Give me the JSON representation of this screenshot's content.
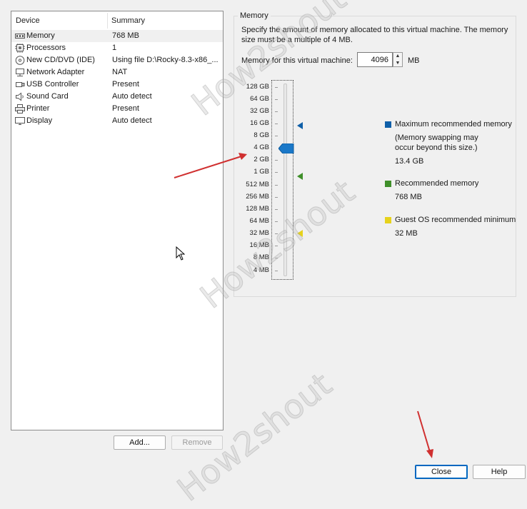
{
  "devices": {
    "header": {
      "device": "Device",
      "summary": "Summary"
    },
    "rows": [
      {
        "icon": "memory-icon",
        "name": "Memory",
        "summary": "768 MB",
        "selected": true
      },
      {
        "icon": "processor-icon",
        "name": "Processors",
        "summary": "1"
      },
      {
        "icon": "cd-dvd-icon",
        "name": "New CD/DVD (IDE)",
        "summary": "Using file D:\\Rocky-8.3-x86_..."
      },
      {
        "icon": "network-adapter-icon",
        "name": "Network Adapter",
        "summary": "NAT"
      },
      {
        "icon": "usb-icon",
        "name": "USB Controller",
        "summary": "Present"
      },
      {
        "icon": "sound-card-icon",
        "name": "Sound Card",
        "summary": "Auto detect"
      },
      {
        "icon": "printer-icon",
        "name": "Printer",
        "summary": "Present"
      },
      {
        "icon": "display-icon",
        "name": "Display",
        "summary": "Auto detect"
      }
    ]
  },
  "buttons": {
    "add": "Add...",
    "remove": "Remove",
    "close": "Close",
    "help": "Help"
  },
  "memory": {
    "group_title": "Memory",
    "description": "Specify the amount of memory allocated to this virtual machine. The memory size must be a multiple of 4 MB.",
    "field_label": "Memory for this virtual machine:",
    "field_value": "4096",
    "unit": "MB",
    "scale_labels": [
      "128 GB",
      "64 GB",
      "32 GB",
      "16 GB",
      "8 GB",
      "4 GB",
      "2 GB",
      "1 GB",
      "512 MB",
      "256 MB",
      "128 MB",
      "64 MB",
      "32 MB",
      "16 MB",
      "8 MB",
      "4 MB"
    ],
    "legend": {
      "max": {
        "color": "#0f5fa8",
        "label": "Maximum recommended memory",
        "note1": "(Memory swapping may",
        "note2": "occur beyond this size.)",
        "value": "13.4 GB"
      },
      "recommended": {
        "color": "#3f8f2a",
        "label": "Recommended memory",
        "value": "768 MB"
      },
      "guest_min": {
        "color": "#e6d21c",
        "label": "Guest OS recommended minimum",
        "value": "32 MB"
      }
    },
    "thumb_color": "#1a78c8"
  },
  "watermark": "How2shout",
  "annotation_color": "#d03030"
}
